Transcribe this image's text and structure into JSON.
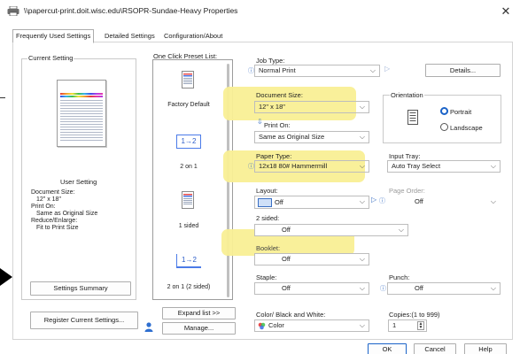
{
  "window": {
    "title": "\\\\papercut-print.doit.wisc.edu\\RSOPR-Sundae-Heavy Properties",
    "close_glyph": "✕"
  },
  "tabs": [
    {
      "label": "Frequently Used Settings",
      "active": true
    },
    {
      "label": "Detailed Settings",
      "active": false
    },
    {
      "label": "Configuration/About",
      "active": false
    }
  ],
  "current_setting": {
    "group_label": "Current Setting",
    "user_setting_label": "User Setting",
    "document_size_label": "Document Size:",
    "document_size_value": "12\" x 18\"",
    "print_on_label": "Print On:",
    "print_on_value": "Same as Original Size",
    "reduce_enlarge_label": "Reduce/Enlarge:",
    "reduce_enlarge_value": "Fit to Print Size",
    "settings_summary_button": "Settings Summary",
    "register_button": "Register Current Settings..."
  },
  "preset": {
    "group_label": "One Click Preset List:",
    "items": [
      {
        "label": "Factory Default",
        "icon": "document-icon"
      },
      {
        "label": "2 on 1",
        "icon": "two-on-one-icon",
        "glyph": "1→2"
      },
      {
        "label": "1 sided",
        "icon": "one-sided-icon"
      },
      {
        "label": "2 on 1 (2 sided)",
        "icon": "two-on-one-two-sided-icon",
        "glyph": "1→2"
      }
    ],
    "expand_button": "Expand list >>",
    "manage_button": "Manage..."
  },
  "job_type": {
    "label": "Job Type:",
    "value": "Normal Print",
    "details_button": "Details..."
  },
  "document_size": {
    "label": "Document Size:",
    "value": "12\" x 18\"",
    "print_on_label": "Print On:",
    "print_on_value": "Same as Original Size"
  },
  "orientation": {
    "label": "Orientation",
    "options": [
      "Portrait",
      "Landscape"
    ],
    "selected": "Portrait"
  },
  "paper_type": {
    "label": "Paper Type:",
    "value": "12x18 80# Hammermill"
  },
  "input_tray": {
    "label": "Input Tray:",
    "value": "Auto Tray Select"
  },
  "layout": {
    "label": "Layout:",
    "value": "Off"
  },
  "page_order": {
    "label": "Page Order:",
    "value": "Off"
  },
  "two_sided": {
    "label": "2 sided:",
    "value": "Off"
  },
  "booklet": {
    "label": "Booklet:",
    "value": "Off"
  },
  "staple": {
    "label": "Staple:",
    "value": "Off"
  },
  "punch": {
    "label": "Punch:",
    "value": "Off"
  },
  "color_mode": {
    "label": "Color/ Black and White:",
    "value": "Color"
  },
  "copies": {
    "label": "Copies:(1 to 999)",
    "value": "1"
  },
  "footer": {
    "ok": "OK",
    "cancel": "Cancel",
    "help": "Help"
  },
  "colors": {
    "highlight": "#f9ef95",
    "accent": "#1b63c8",
    "info": "#3a6fc4"
  }
}
